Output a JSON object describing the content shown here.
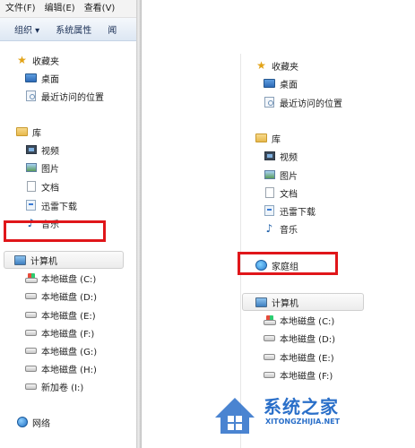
{
  "left": {
    "menu": [
      "文件(F)",
      "编辑(E)",
      "查看(V)"
    ],
    "toolbar": {
      "organize": "组织 ▾",
      "system_props": "系统属性",
      "overflow": "闻"
    },
    "favorites": {
      "label": "收藏夹",
      "items": [
        "桌面",
        "最近访问的位置"
      ]
    },
    "libraries": {
      "label": "库",
      "items": [
        "视频",
        "图片",
        "文档",
        "迅雷下载",
        "音乐"
      ]
    },
    "computer": {
      "label": "计算机",
      "drives": [
        "本地磁盘 (C:)",
        "本地磁盘 (D:)",
        "本地磁盘 (E:)",
        "本地磁盘 (F:)",
        "本地磁盘 (G:)",
        "本地磁盘 (H:)",
        "新加卷 (I:)"
      ]
    },
    "network": {
      "label": "网络"
    }
  },
  "right": {
    "favorites": {
      "label": "收藏夹",
      "items": [
        "桌面",
        "最近访问的位置"
      ]
    },
    "libraries": {
      "label": "库",
      "items": [
        "视频",
        "图片",
        "文档",
        "迅雷下载",
        "音乐"
      ]
    },
    "homegroup": {
      "label": "家庭组"
    },
    "computer": {
      "label": "计算机",
      "drives": [
        "本地磁盘 (C:)",
        "本地磁盘 (D:)",
        "本地磁盘 (E:)",
        "本地磁盘 (F:)"
      ]
    }
  },
  "watermark": {
    "title": "系统之家",
    "url": "XITONGZHIJIA.NET"
  },
  "colors": {
    "highlight_red": "#e0161a",
    "watermark_blue": "#2a6fc9"
  }
}
